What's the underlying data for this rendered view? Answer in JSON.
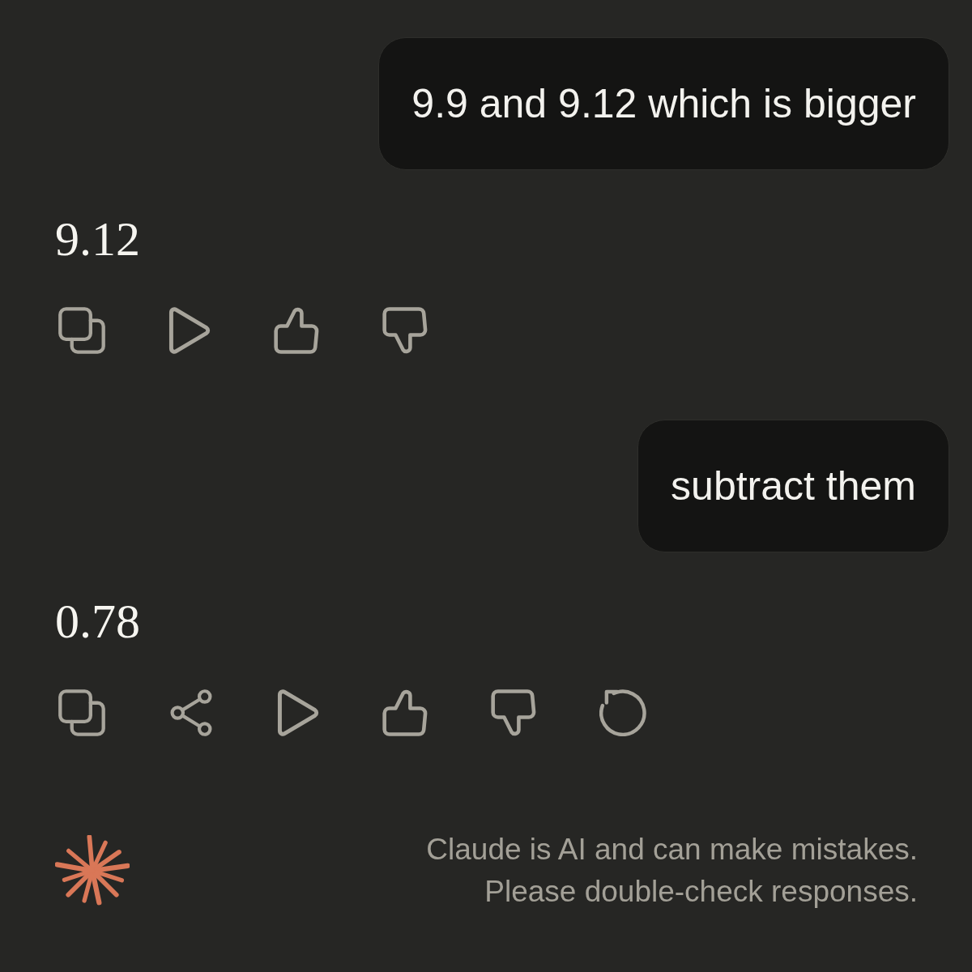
{
  "messages": [
    {
      "kind": "user",
      "text": "9.9 and 9.12 which is bigger"
    },
    {
      "kind": "assistant",
      "text": "9.12",
      "actions": [
        {
          "kind": "copy"
        },
        {
          "kind": "play"
        },
        {
          "kind": "thumbs_up"
        },
        {
          "kind": "thumbs_down"
        }
      ]
    },
    {
      "kind": "user",
      "text": "subtract them"
    },
    {
      "kind": "assistant",
      "text": "0.78",
      "actions": [
        {
          "kind": "copy"
        },
        {
          "kind": "share"
        },
        {
          "kind": "play"
        },
        {
          "kind": "thumbs_up"
        },
        {
          "kind": "thumbs_down"
        },
        {
          "kind": "retry"
        }
      ]
    }
  ],
  "footer": {
    "disclaimer": [
      "Claude is AI and can make mistakes.",
      "Please double-check responses."
    ]
  }
}
